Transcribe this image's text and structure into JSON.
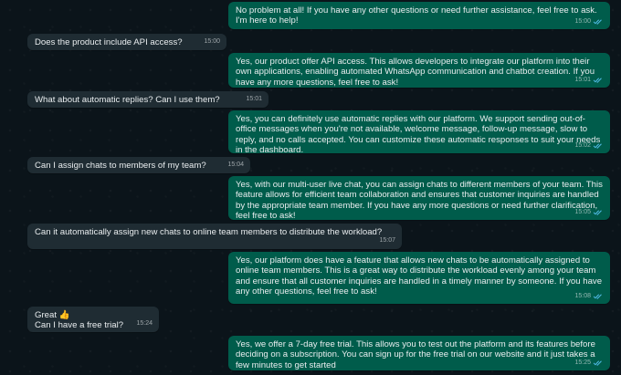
{
  "chat": {
    "messages": [
      {
        "from": "business",
        "text": "No problem at all! If you have any other questions or need further assistance, feel free to ask. I'm here to help!",
        "time": "15:00",
        "status": "read"
      },
      {
        "from": "customer",
        "text": "Does the product include API access?",
        "time": "15:00"
      },
      {
        "from": "business",
        "text": "Yes, our product offer API access. This allows developers to integrate our platform into their own applications, enabling automated WhatsApp communication and chatbot creation. If you have any more questions, feel free to ask!",
        "time": "15:01",
        "status": "read"
      },
      {
        "from": "customer",
        "text": "What about automatic replies? Can I use them?",
        "time": "15:01"
      },
      {
        "from": "business",
        "text": "Yes, you can definitely use automatic replies with our platform. We support sending out-of-office messages when you're not available, welcome message, follow-up message, slow to reply, and no calls accepted. You can customize these automatic responses to suit your needs in the dashboard.",
        "time": "15:02",
        "status": "read"
      },
      {
        "from": "customer",
        "text": "Can I assign chats to members of my team?",
        "time": "15:04"
      },
      {
        "from": "business",
        "text": "Yes, with our multi-user live chat, you can assign chats to different members of your team. This feature allows for efficient team collaboration and ensures that customer inquiries are handled by the appropriate team member. If you have any more questions or need further clarification, feel free to ask!",
        "time": "15:05",
        "status": "read"
      },
      {
        "from": "customer",
        "text": "Can it automatically assign new chats to online team members to distribute the workload?",
        "time": "15:07"
      },
      {
        "from": "business",
        "text": "Yes, our platform does have a feature that allows new chats to be automatically assigned to online team members. This is a great way to distribute the workload evenly among your team and ensure that all customer inquiries are handled in a timely manner by someone. If you have any other questions, feel free to ask!",
        "time": "15:08",
        "status": "read"
      },
      {
        "from": "customer",
        "text": "Great 👍\nCan I have a free trial?",
        "time": "15:24"
      },
      {
        "from": "business",
        "text": "Yes, we offer a 7-day free trial. This allows you to test out the platform and its features before deciding on a subscription. You can sign up for the free trial on our website and it just takes a few minutes to get started",
        "time": "15:25",
        "status": "read"
      }
    ]
  },
  "colors": {
    "background": "#0b141a",
    "incoming_bubble": "#1f2c33",
    "outgoing_bubble": "#005c4b",
    "read_ticks": "#53bdeb"
  },
  "icons": {
    "read_receipt": "double-check-icon"
  }
}
